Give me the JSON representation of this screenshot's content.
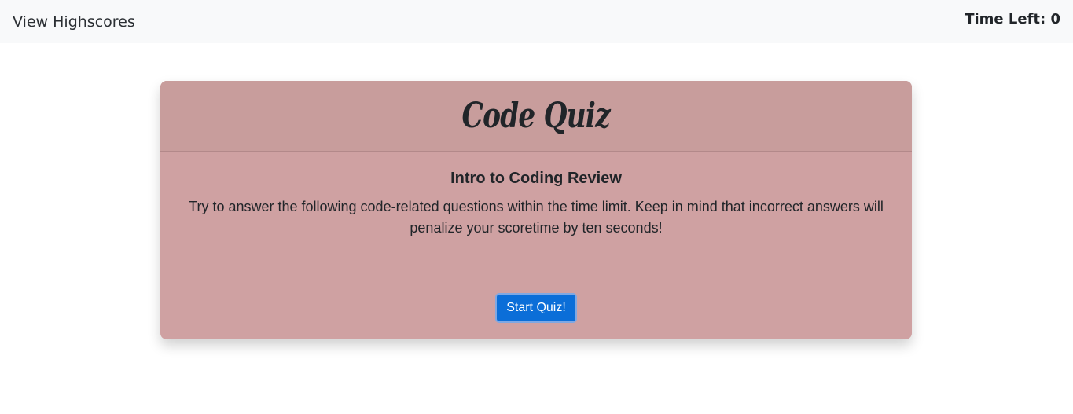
{
  "navbar": {
    "highscores_link": "View Highscores",
    "timer_label": "Time Left: 0"
  },
  "quiz": {
    "title": "Code Quiz",
    "subtitle": "Intro to Coding Review",
    "intro": "Try to answer the following code-related questions within the time limit. Keep in mind that incorrect answers will penalize your scoretime by ten seconds!",
    "start_button": "Start Quiz!"
  },
  "colors": {
    "navbar_bg": "#f8f9fa",
    "card_bg": "#cfa1a2",
    "card_header_bg": "#c89d9c",
    "button_bg": "#0b6ed8"
  }
}
